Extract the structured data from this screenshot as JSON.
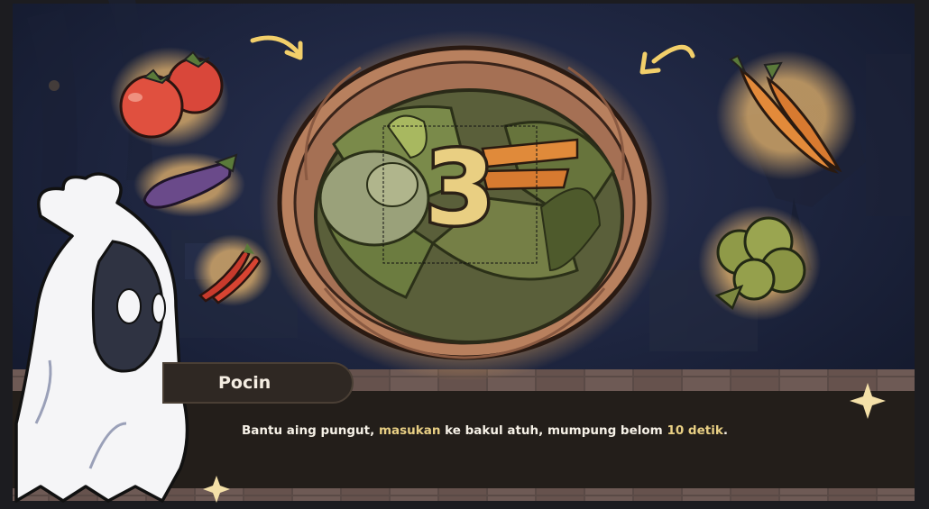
{
  "game": {
    "countdown": "3",
    "speaker": "Pocin",
    "dialog": {
      "part1": "Bantu aing pungut, ",
      "highlight1": "masukan",
      "part2": " ke bakul atuh, mumpung belom ",
      "highlight2": "10 detik",
      "part3": "."
    }
  },
  "items": [
    "tomato-icon",
    "eggplant-icon",
    "chili-icon",
    "carrot-icon",
    "lettuce-icon",
    "basket-icon"
  ],
  "colors": {
    "background": "#1e2540",
    "dialog_bar": "#231e1a",
    "highlight": "#e8cf84",
    "countdown_fill": "#e9cf82",
    "glow": "#f4b85c"
  }
}
